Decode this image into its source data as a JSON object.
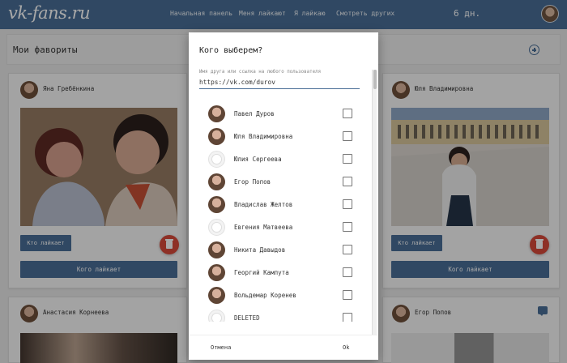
{
  "header": {
    "logo": "vk-fans.ru",
    "nav": [
      "Начальная панель",
      "Меня лайкают",
      "Я лайкаю",
      "Смотреть других"
    ],
    "days": "6 дн."
  },
  "favorites": {
    "title": "Мои фавориты"
  },
  "cards": [
    {
      "name": "Яна Гребёнкина",
      "likes_button": "Кто лайкает",
      "liked_button": "Кого лайкает"
    },
    {
      "name": "Юля Владимировна",
      "likes_button": "Кто лайкает",
      "liked_button": "Кого лайкает"
    },
    {
      "name": "Анастасия Корнеева"
    },
    {
      "name": "Егор Попов"
    }
  ],
  "dialog": {
    "title": "Кого выберем?",
    "field_label": "Имя друга или ссылка на любого пользователя",
    "field_value": "https://vk.com/durov",
    "people": [
      "Павел Дуров",
      "Юля Владимировна",
      "Юлия Сергеева",
      "Егор Попов",
      "Владислав Желтов",
      "Евгения Матвеева",
      "Никита Давыдов",
      "Георгий Кампута",
      "Вольдемар Коренев",
      "DELETED"
    ],
    "cancel": "Отмена",
    "ok": "Ok"
  },
  "colors": {
    "topbar": "#4a6e96",
    "accent": "#4a6e96",
    "delete": "#d84a3b"
  },
  "icons": [
    "add-circle-icon",
    "trash-icon",
    "chat-icon"
  ]
}
